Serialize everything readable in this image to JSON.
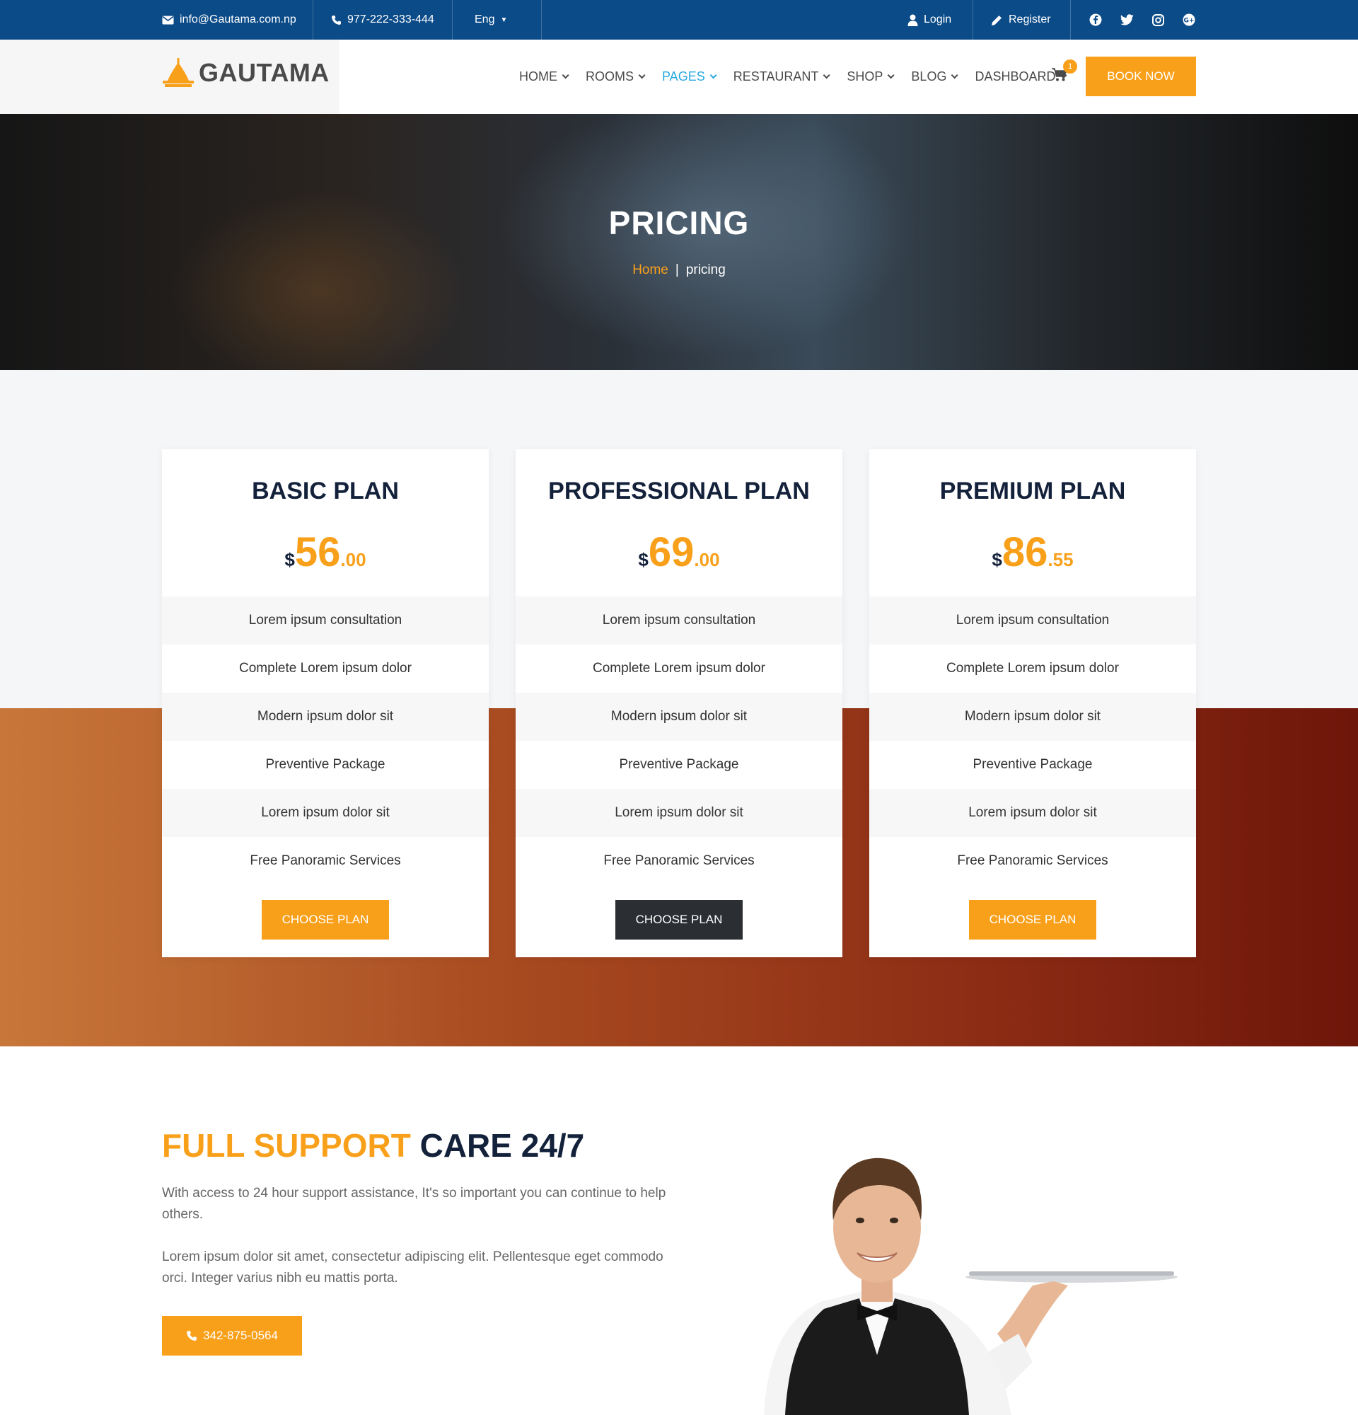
{
  "topbar": {
    "email": "info@Gautama.com.np",
    "phone": "977-222-333-444",
    "language": "Eng",
    "login": "Login",
    "register": "Register"
  },
  "header": {
    "logo": "GAUTAMA",
    "nav": [
      {
        "label": "HOME",
        "active": false
      },
      {
        "label": "ROOMS",
        "active": false
      },
      {
        "label": "PAGES",
        "active": true
      },
      {
        "label": "RESTAURANT",
        "active": false
      },
      {
        "label": "SHOP",
        "active": false
      },
      {
        "label": "BLOG",
        "active": false
      },
      {
        "label": "DASHBOARD",
        "active": false
      }
    ],
    "cart_count": "1",
    "book_now": "BOOK NOW"
  },
  "hero": {
    "title": "PRICING",
    "breadcrumb_home": "Home",
    "breadcrumb_sep": "|",
    "breadcrumb_current": "pricing"
  },
  "plans": [
    {
      "title": "BASIC PLAN",
      "currency": "$",
      "price_whole": "56",
      "price_cents": ".00",
      "features": [
        "Lorem ipsum consultation",
        "Complete Lorem ipsum dolor",
        "Modern ipsum dolor sit",
        "Preventive Package",
        "Lorem ipsum dolor sit",
        "Free Panoramic Services"
      ],
      "button": "CHOOSE PLAN"
    },
    {
      "title": "PROFESSIONAL PLAN",
      "currency": "$",
      "price_whole": "69",
      "price_cents": ".00",
      "features": [
        "Lorem ipsum consultation",
        "Complete Lorem ipsum dolor",
        "Modern ipsum dolor sit",
        "Preventive Package",
        "Lorem ipsum dolor sit",
        "Free Panoramic Services"
      ],
      "button": "CHOOSE PLAN"
    },
    {
      "title": "PREMIUM PLAN",
      "currency": "$",
      "price_whole": "86",
      "price_cents": ".55",
      "features": [
        "Lorem ipsum consultation",
        "Complete Lorem ipsum dolor",
        "Modern ipsum dolor sit",
        "Preventive Package",
        "Lorem ipsum dolor sit",
        "Free Panoramic Services"
      ],
      "button": "CHOOSE PLAN"
    }
  ],
  "support": {
    "title_accent": "FULL SUPPORT",
    "title_rest": " CARE 24/7",
    "para1": "With access to 24 hour support assistance, It's so important you can continue to help others.",
    "para2": "Lorem ipsum dolor sit amet, consectetur adipiscing elit. Pellentesque eget commodo orci. Integer varius nibh eu mattis porta.",
    "phone": "342-875-0564"
  },
  "colors": {
    "topbar": "#0b4b88",
    "accent": "#f9a01b",
    "nav_active": "#29a9e0",
    "heading": "#13213a",
    "dark_button": "#2b2e33"
  }
}
